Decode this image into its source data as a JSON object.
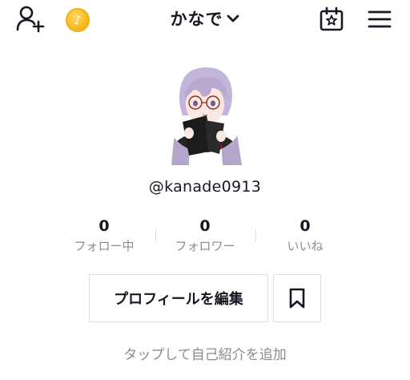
{
  "header": {
    "title": "かなで",
    "icons": {
      "add_friend": "add-person-icon",
      "coin": "coin-icon",
      "dropdown": "chevron-down-icon",
      "calendar": "calendar-star-icon",
      "menu": "hamburger-menu-icon"
    }
  },
  "profile": {
    "username": "@kanade0913",
    "avatar": "avatar-illustration"
  },
  "stats": [
    {
      "value": "0",
      "label": "フォロー中"
    },
    {
      "value": "0",
      "label": "フォロワー"
    },
    {
      "value": "0",
      "label": "いいね"
    }
  ],
  "actions": {
    "edit_profile": "プロフィールを編集",
    "bookmark_icon": "bookmark-icon"
  },
  "bio_prompt": "タップして自己紹介を追加",
  "colors": {
    "text": "#161823",
    "secondary_text": "#8a8b91",
    "coin": "#f4b81c",
    "border": "#d9dadd"
  }
}
